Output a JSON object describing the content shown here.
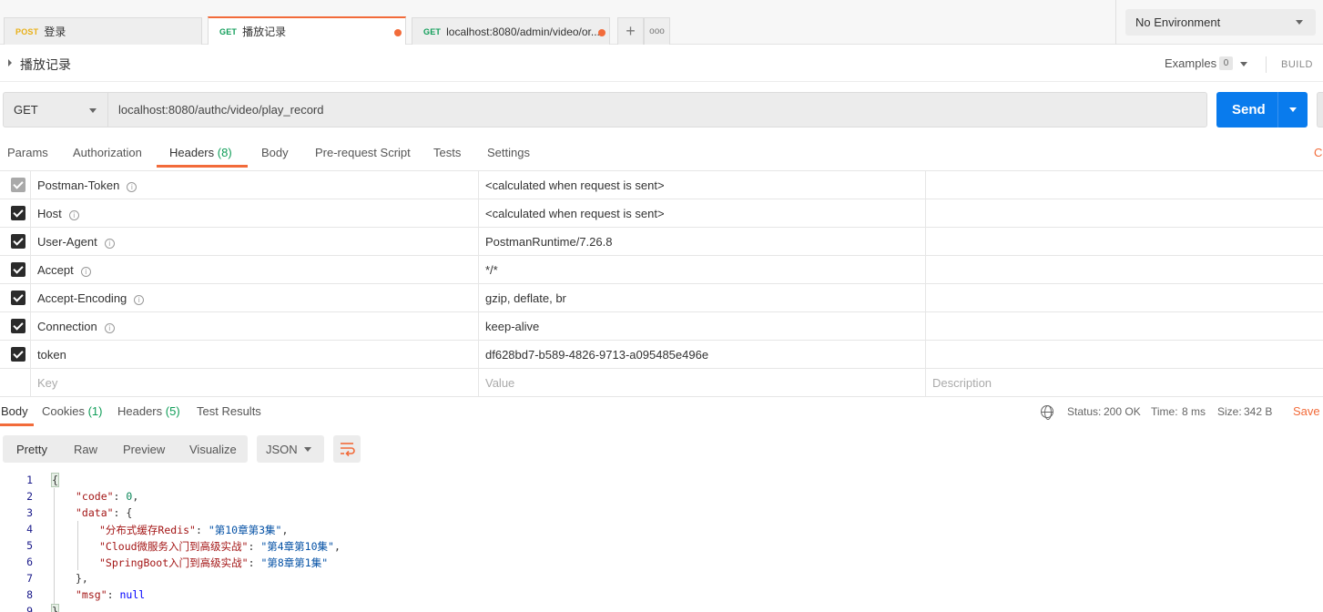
{
  "tabs": [
    {
      "method": "POST",
      "label": "登录",
      "unsaved": false,
      "active": false
    },
    {
      "method": "GET",
      "label": "播放记录",
      "unsaved": true,
      "active": true
    },
    {
      "method": "GET",
      "label": "localhost:8080/admin/video/or...",
      "unsaved": true,
      "active": false
    }
  ],
  "tab_actions": {
    "add": "+",
    "more": "ooo"
  },
  "environment": "No Environment",
  "request": {
    "title": "播放记录",
    "examples_label": "Examples",
    "examples_count": "0",
    "build_label": "BUILD",
    "method": "GET",
    "url": "localhost:8080/authc/video/play_record",
    "send_label": "Send"
  },
  "request_tabs": {
    "params": "Params",
    "authorization": "Authorization",
    "headers": "Headers",
    "headers_count": "(8)",
    "body": "Body",
    "prerequest": "Pre-request Script",
    "tests": "Tests",
    "settings": "Settings",
    "cookies_edge": "Co"
  },
  "headers": [
    {
      "key": "Postman-Token",
      "value": "<calculated when request is sent>",
      "checked": true,
      "disabled": true,
      "info": true
    },
    {
      "key": "Host",
      "value": "<calculated when request is sent>",
      "checked": true,
      "disabled": false,
      "info": true
    },
    {
      "key": "User-Agent",
      "value": "PostmanRuntime/7.26.8",
      "checked": true,
      "disabled": false,
      "info": true
    },
    {
      "key": "Accept",
      "value": "*/*",
      "checked": true,
      "disabled": false,
      "info": true
    },
    {
      "key": "Accept-Encoding",
      "value": "gzip, deflate, br",
      "checked": true,
      "disabled": false,
      "info": true
    },
    {
      "key": "Connection",
      "value": "keep-alive",
      "checked": true,
      "disabled": false,
      "info": true
    },
    {
      "key": "token",
      "value": "df628bd7-b589-4826-9713-a095485e496e",
      "checked": true,
      "disabled": false,
      "info": false
    }
  ],
  "headers_placeholders": {
    "key": "Key",
    "value": "Value",
    "description": "Description"
  },
  "response_tabs": {
    "body": "Body",
    "cookies": "Cookies",
    "cookies_count": "(1)",
    "headers": "Headers",
    "headers_count": "(5)",
    "test_results": "Test Results"
  },
  "response_status": {
    "status_label": "Status:",
    "status_value": "200 OK",
    "time_label": "Time:",
    "time_value": "8 ms",
    "size_label": "Size:",
    "size_value": "342 B",
    "save_label": "Save R"
  },
  "view_modes": {
    "pretty": "Pretty",
    "raw": "Raw",
    "preview": "Preview",
    "visualize": "Visualize"
  },
  "format": "JSON",
  "code_lines": [
    "1",
    "2",
    "3",
    "4",
    "5",
    "6",
    "7",
    "8",
    "9"
  ],
  "response_body": {
    "code_key": "\"code\"",
    "code_value": "0",
    "data_key": "\"data\"",
    "entries": [
      {
        "key": "\"分布式缓存Redis\"",
        "value": "\"第10章第3集\""
      },
      {
        "key": "\"Cloud微服务入门到高级实战\"",
        "value": "\"第4章第10集\""
      },
      {
        "key": "\"SpringBoot入门到高级实战\"",
        "value": "\"第8章第1集\""
      }
    ],
    "msg_key": "\"msg\"",
    "msg_value": "null"
  },
  "colors": {
    "accent": "#f26b3a",
    "send": "#097bed",
    "status_ok": "#0f9d58",
    "post": "#e9b017",
    "get": "#0f9d58"
  }
}
